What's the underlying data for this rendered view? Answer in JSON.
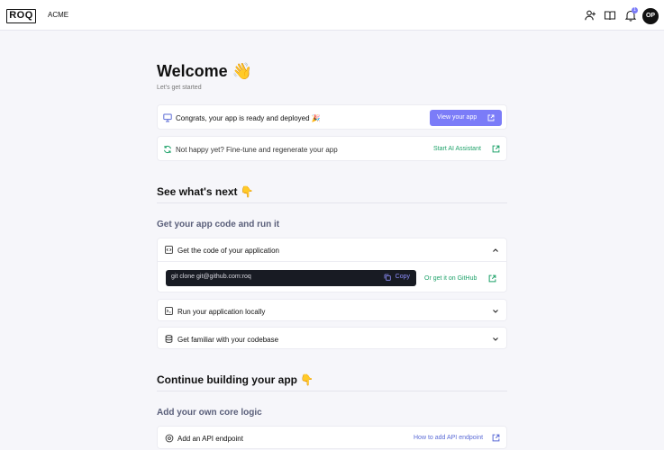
{
  "header": {
    "logo_text": "ROQ",
    "org_name": "ACME",
    "notification_count": "1",
    "avatar_initials": "OP",
    "icons": [
      "add-user-icon",
      "book-icon",
      "bell-icon"
    ]
  },
  "welcome": {
    "title": "Welcome 👋",
    "subtitle": "Let's get started"
  },
  "deploy_card": {
    "message": "Congrats, your app is ready and deployed 🎉",
    "button_label": "View your app"
  },
  "regen_card": {
    "message": "Not happy yet? Fine-tune and regenerate your app",
    "link_label": "Start AI Assistant"
  },
  "see_whats_next": {
    "title": "See what's next 👇",
    "group_title": "Get your app code and run it",
    "items": [
      {
        "label": "Get the code of your application",
        "expanded": true
      },
      {
        "label": "Run your application locally",
        "expanded": false
      },
      {
        "label": "Get familiar with your codebase",
        "expanded": false
      }
    ],
    "code_command": "git clone git@github.com:roq",
    "copy_label": "Copy",
    "github_link": "Or get it on GitHub"
  },
  "continue_building": {
    "title": "Continue building your app 👇",
    "group_title": "Add your own core logic",
    "items": [
      {
        "label": "Add an API endpoint",
        "link": "How to add API endpoint"
      }
    ]
  },
  "colors": {
    "accent": "#7b7cf8",
    "link_green": "#1fa26a",
    "link_blue": "#5b6bd6",
    "page_bg": "#f6f6fa",
    "code_bg": "#181b23"
  }
}
